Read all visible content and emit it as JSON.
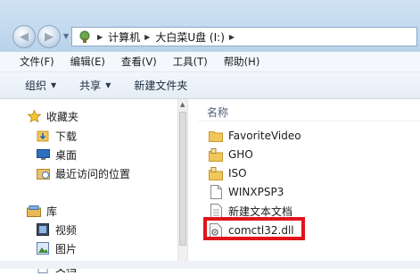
{
  "address": {
    "crumbs": [
      "计算机",
      "大白菜U盘 (I:)"
    ]
  },
  "menu": [
    "文件(F)",
    "编辑(E)",
    "查看(V)",
    "工具(T)",
    "帮助(H)"
  ],
  "commands": {
    "organize": "组织",
    "share": "共享",
    "new_folder": "新建文件夹"
  },
  "nav": {
    "favorites": "收藏夹",
    "downloads": "下载",
    "desktop": "桌面",
    "recent": "最近访问的位置",
    "libraries": "库",
    "videos": "视频",
    "pictures": "图片",
    "documents": "文档"
  },
  "content": {
    "column_name": "名称",
    "files": [
      {
        "name": "FavoriteVideo",
        "icon": "folder-icon"
      },
      {
        "name": "GHO",
        "icon": "folder-lock-icon"
      },
      {
        "name": "ISO",
        "icon": "folder-lock-icon"
      },
      {
        "name": "WINXPSP3",
        "icon": "file-icon"
      },
      {
        "name": "新建文本文档",
        "icon": "text-file-icon"
      },
      {
        "name": "comctl32.dll",
        "icon": "dll-file-icon"
      }
    ],
    "highlight_color": "#e0141b"
  }
}
